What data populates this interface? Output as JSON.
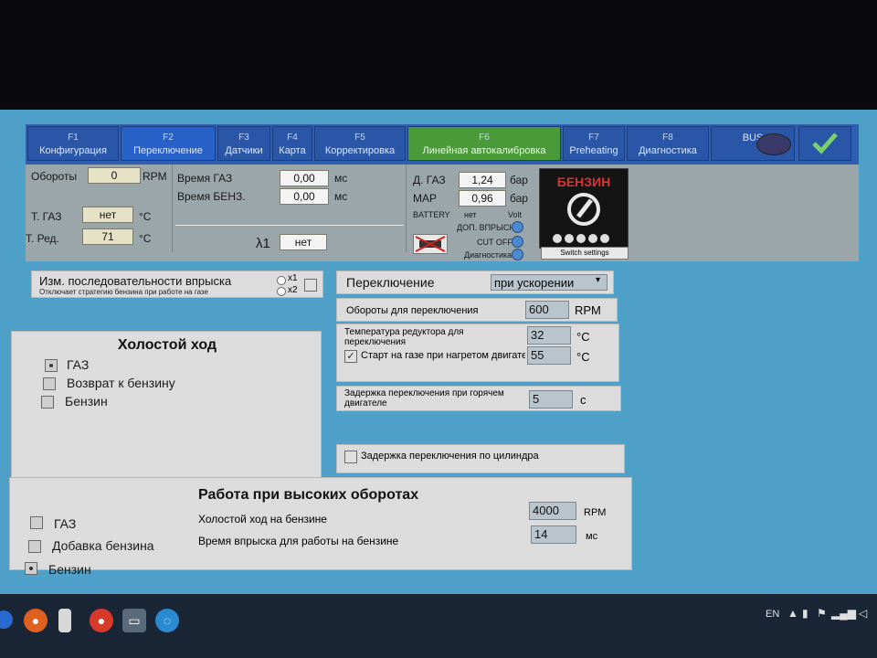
{
  "fkeys": [
    {
      "key": "F1",
      "label": "Конфигурация"
    },
    {
      "key": "F2",
      "label": "Переключение"
    },
    {
      "key": "F3",
      "label": "Датчики"
    },
    {
      "key": "F4",
      "label": "Карта"
    },
    {
      "key": "F5",
      "label": "Корректировка"
    },
    {
      "key": "F6",
      "label": "Линейная автокалибровка"
    },
    {
      "key": "F7",
      "label": "Preheating"
    },
    {
      "key": "F8",
      "label": "Диагностика"
    },
    {
      "key": "",
      "label": "BUS"
    }
  ],
  "status": {
    "rpm_label": "Обороты",
    "rpm_value": "0",
    "rpm_unit": "RPM",
    "tgas_label": "Т. ГАЗ",
    "tgas_value": "нет",
    "tgas_unit": "°C",
    "tred_label": "Т. Ред.",
    "tred_value": "71",
    "tred_unit": "°C",
    "time_gas_label": "Время ГАЗ",
    "time_gas_value": "0,00",
    "time_gas_unit": "мс",
    "time_benz_label": "Время БЕНЗ.",
    "time_benz_value": "0,00",
    "time_benz_unit": "мс",
    "lambda_label": "λ1",
    "lambda_value": "нет",
    "pgas_label": "Д. ГАЗ",
    "pgas_value": "1,24",
    "pgas_unit": "бар",
    "map_label": "MAP",
    "map_value": "0,96",
    "map_unit": "бар",
    "battery_label": "BATTERY",
    "battery_value": "нет",
    "battery_unit": "Volt",
    "ind_extra": "ДОП. ВПРЫСК",
    "ind_cutoff": "CUT OFF",
    "ind_diag": "Диагностика",
    "fuel_mode": "БЕНЗИН",
    "switch_settings": "Switch settings"
  },
  "injection": {
    "title": "Изм. последовательности впрыска",
    "subtitle": "Отключает стратегию бензина при работе на газе",
    "x1": "x1",
    "x2": "x2"
  },
  "idle": {
    "title": "Холостой ход",
    "options": [
      "ГАЗ",
      "Возврат к бензину",
      "Бензин"
    ]
  },
  "switching": {
    "label": "Переключение",
    "select_value": "при ускорении",
    "rpm_label": "Обороты для переключения",
    "rpm_value": "600",
    "rpm_unit": "RPM",
    "temp_label": "Температура редуктора для переключения",
    "temp_value": "32",
    "temp_unit": "°C",
    "start_label": "Старт на газе при нагретом двигате",
    "start_value": "55",
    "start_unit": "°C",
    "delay_label": "Задержка переключения при горячем двигателе",
    "delay_value": "5",
    "delay_unit": "с",
    "cyl_label": "Задержка переключения по цилиндра"
  },
  "high_rpm": {
    "title": "Работа при высоких оборотах",
    "options": [
      "ГАЗ",
      "Добавка бензина",
      "Бензин"
    ],
    "idle_label": "Холостой ход на бензине",
    "idle_value": "4000",
    "idle_unit": "RPM",
    "inj_label": "Время впрыска для работы на бензине",
    "inj_value": "14",
    "inj_unit": "мс"
  },
  "taskbar": {
    "lang": "EN"
  }
}
